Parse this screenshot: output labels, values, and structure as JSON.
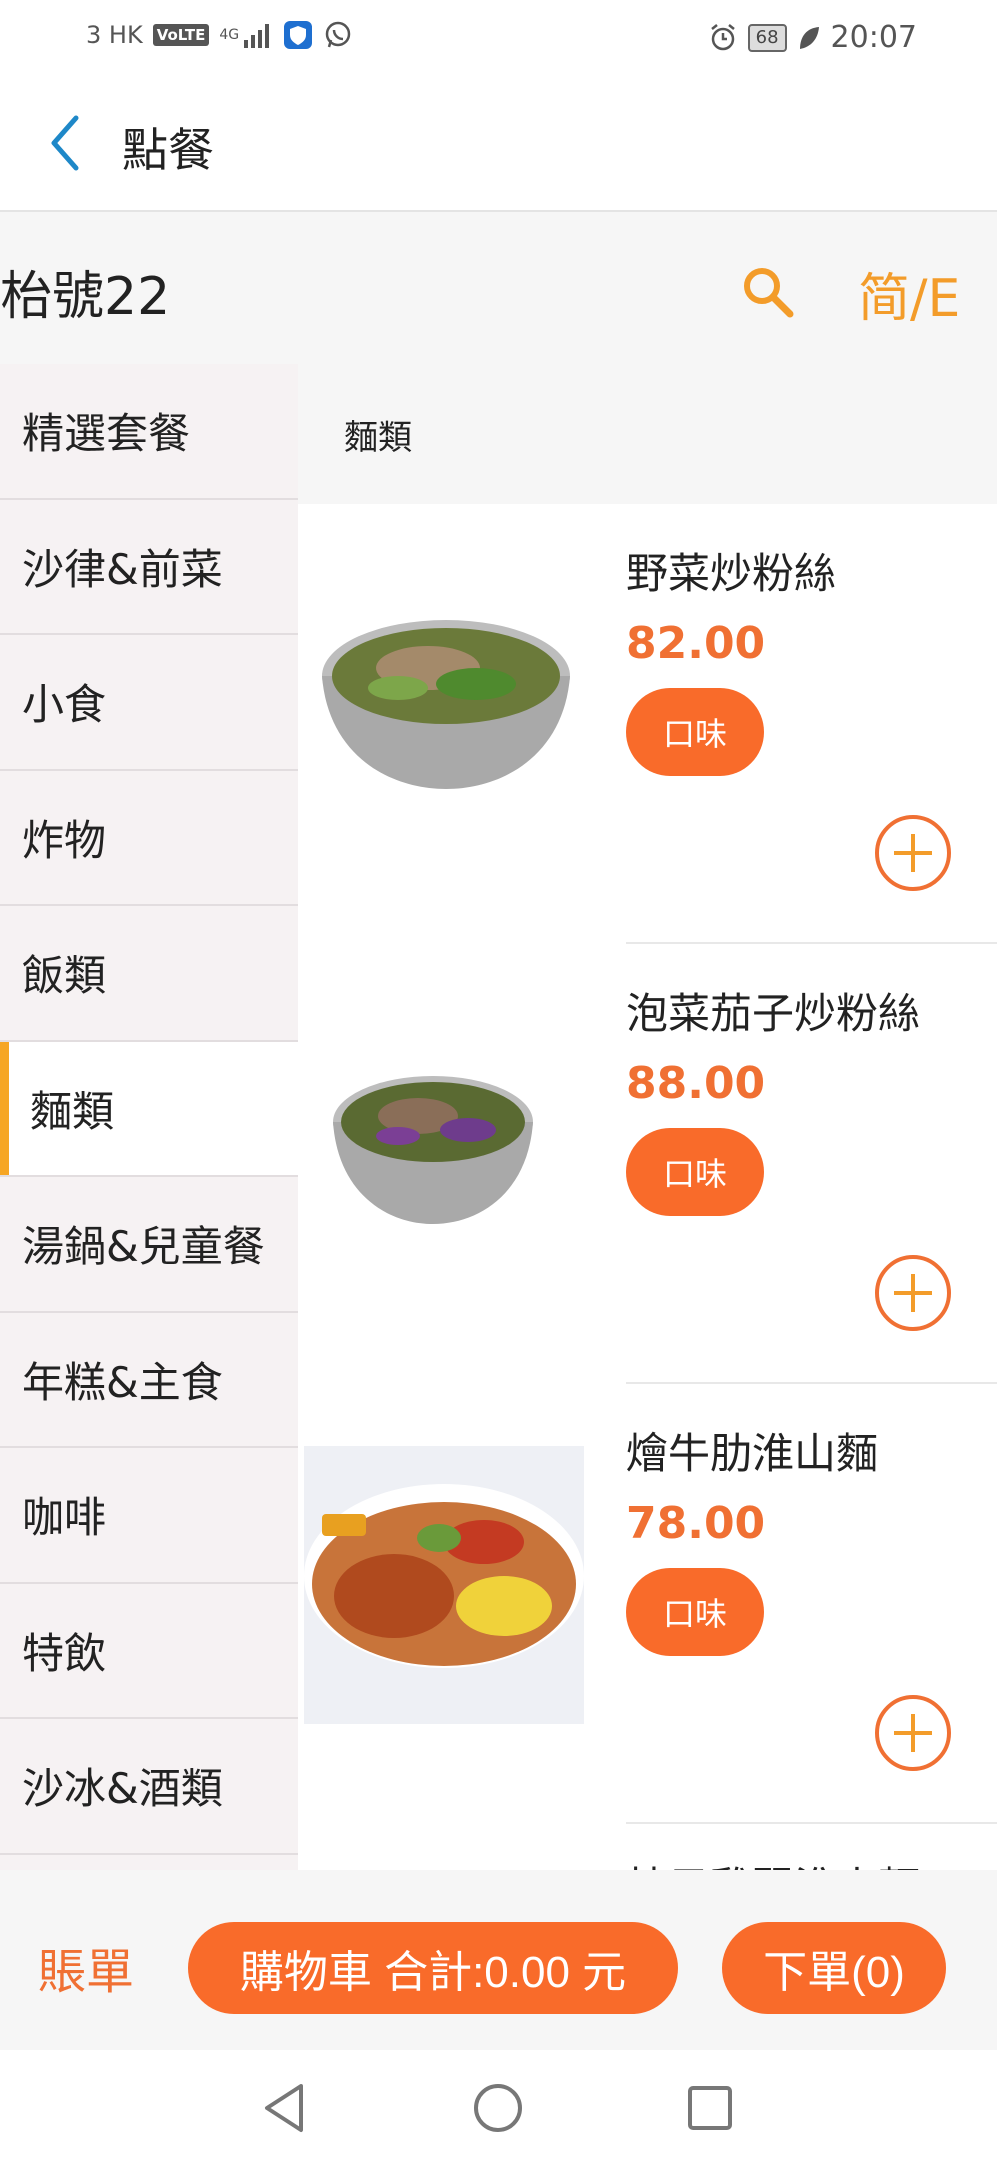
{
  "status_bar": {
    "carrier": "3 HK",
    "volte": "VoLTE",
    "network": "4G",
    "battery": "68",
    "time": "20:07"
  },
  "header": {
    "title": "點餐",
    "back_icon": "chevron-left-icon"
  },
  "table": {
    "label": "枱號22",
    "search_icon": "search-icon",
    "lang_switch": "简/E"
  },
  "categories": [
    {
      "label": "精選套餐"
    },
    {
      "label": "沙律&前菜"
    },
    {
      "label": "小食"
    },
    {
      "label": "炸物"
    },
    {
      "label": "飯類"
    },
    {
      "label": "麵類",
      "active": true
    },
    {
      "label": "湯鍋&兒童餐"
    },
    {
      "label": "年糕&主食"
    },
    {
      "label": "咖啡"
    },
    {
      "label": "特飲"
    },
    {
      "label": "沙冰&酒類"
    }
  ],
  "section": {
    "title": "麵類"
  },
  "items": [
    {
      "name": "野菜炒粉絲",
      "price": "82.00",
      "flavor_label": "口味"
    },
    {
      "name": "泡菜茄子炒粉絲",
      "price": "88.00",
      "flavor_label": "口味"
    },
    {
      "name": "燴牛肋淮山麵",
      "price": "78.00",
      "flavor_label": "口味"
    },
    {
      "name": "柚子雞翼淮山麵"
    }
  ],
  "bottom": {
    "bill": "賬單",
    "cart": "購物車 合計:0.00 元",
    "order": "下單(0)"
  },
  "colors": {
    "accent": "#f96b2a",
    "price": "#f07033",
    "category_indicator": "#f6a623",
    "lang_switch": "#f39c2a",
    "back_icon": "#1e88c8"
  }
}
